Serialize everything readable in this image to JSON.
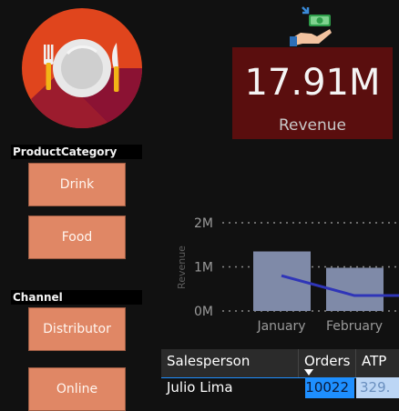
{
  "kpi": {
    "value": "17.91M",
    "label": "Revenue"
  },
  "icons": {
    "logo": "dinner-plate-fork-knife-icon",
    "kpi": "money-in-hand-icon"
  },
  "slicers": [
    {
      "title": "ProductCategory",
      "options": [
        "Drink",
        "Food"
      ]
    },
    {
      "title": "Channel",
      "options": [
        "Distributor",
        "Online"
      ]
    }
  ],
  "chart_data": {
    "type": "bar",
    "categories": [
      "January",
      "February"
    ],
    "series": [
      {
        "kind": "bar",
        "values": [
          1.35,
          0.98
        ]
      },
      {
        "kind": "line",
        "values": [
          0.8,
          0.35
        ]
      }
    ],
    "ylabel": "Revenue",
    "yticks": [
      "2M",
      "1M",
      "0M"
    ],
    "ylim": [
      0,
      2
    ],
    "colors": {
      "bar": "#7f8aa8",
      "line": "#2f35b8",
      "grid": "#8a8a8a"
    }
  },
  "table": {
    "columns": [
      "Salesperson",
      "Orders",
      "ATP"
    ],
    "sort_icon": "sort-descending-icon",
    "rows": [
      {
        "salesperson": "Julio Lima",
        "orders": "10022",
        "atp": "329."
      }
    ]
  },
  "colors": {
    "background": "#111111",
    "kpi_card": "#5a0e0e",
    "slicer_button": "#e08765",
    "highlight": "#1e8fff"
  }
}
